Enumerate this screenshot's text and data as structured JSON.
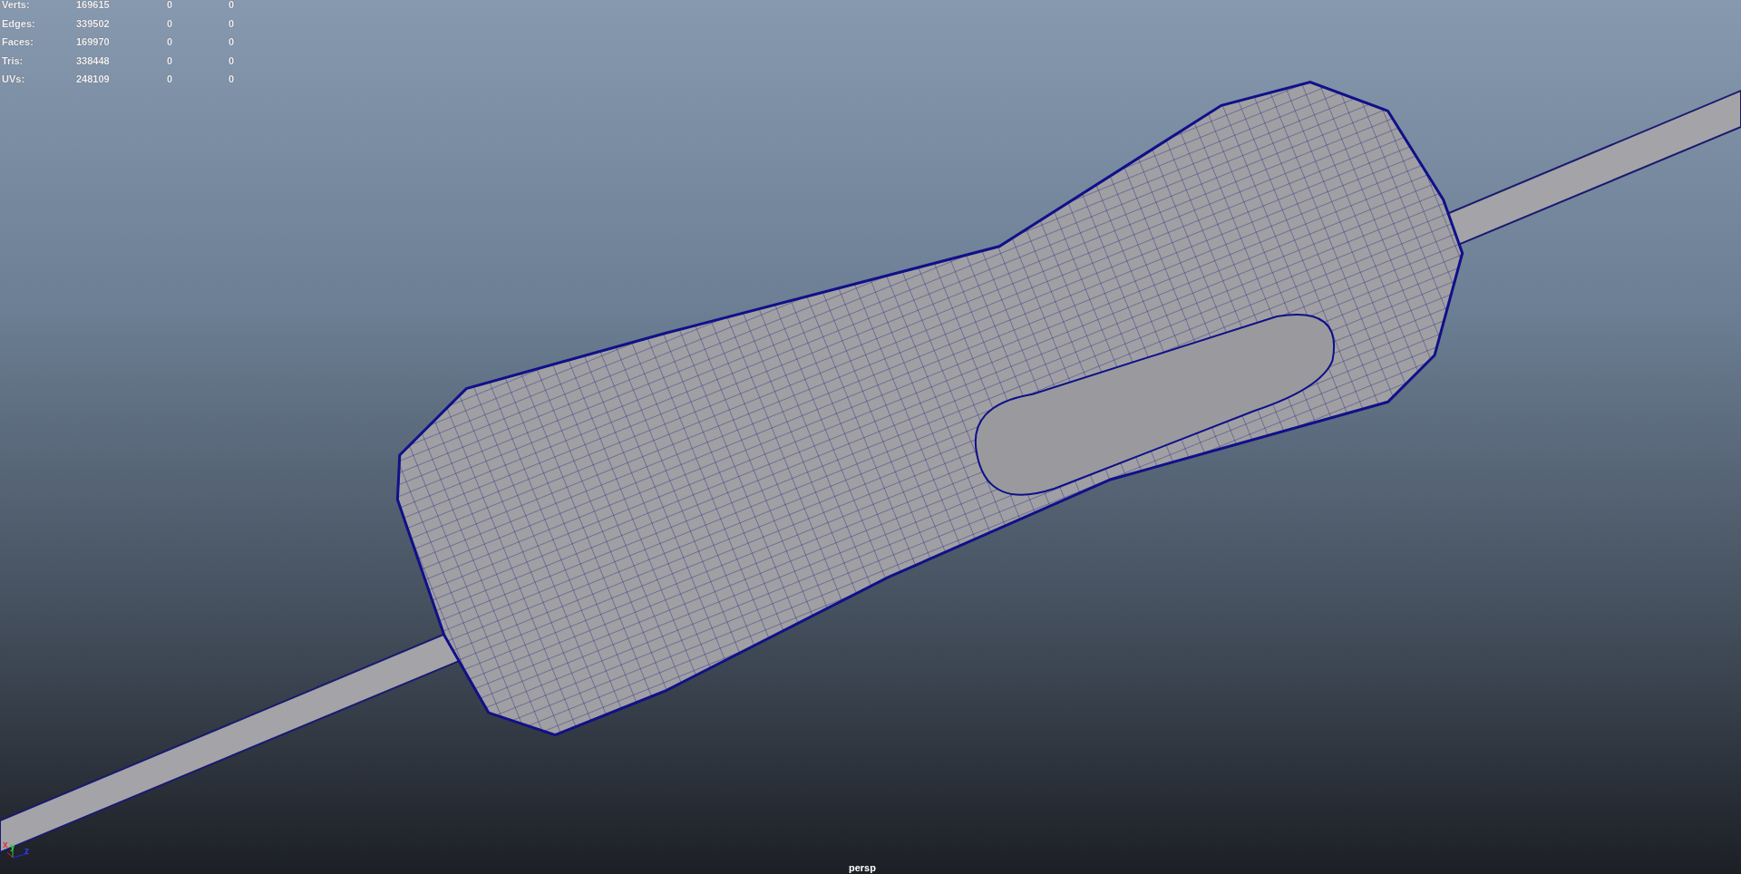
{
  "stats": [
    {
      "label": "Verts:",
      "values": [
        "169615",
        "0",
        "0"
      ]
    },
    {
      "label": "Edges:",
      "values": [
        "339502",
        "0",
        "0"
      ]
    },
    {
      "label": "Faces:",
      "values": [
        "169970",
        "0",
        "0"
      ]
    },
    {
      "label": "Tris:",
      "values": [
        "338448",
        "0",
        "0"
      ]
    },
    {
      "label": "UVs:",
      "values": [
        "248109",
        "0",
        "0"
      ]
    }
  ],
  "axis_labels": [
    "x",
    "y",
    "z"
  ],
  "camera": "persp"
}
